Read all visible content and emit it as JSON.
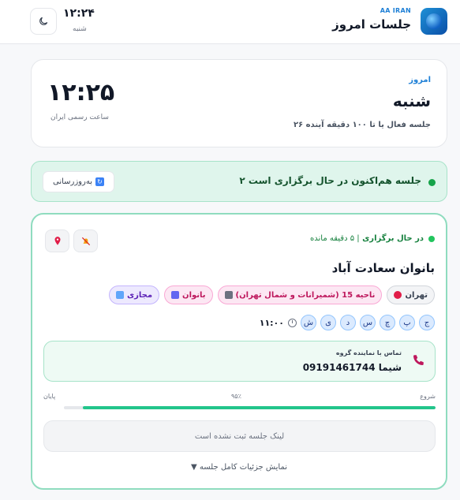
{
  "header": {
    "brand_small": "AA IRAN",
    "title": "جلسات امروز",
    "clock": "۱۲:۲۴",
    "day": "شنبه"
  },
  "today": {
    "label": "امروز",
    "day": "شنبه",
    "count_text": "۲۶ جلسه فعال یا تا ۱۰۰ دقیقه آینده",
    "clock": "۱۲:۲۵",
    "clock_sub": "ساعت رسمی ایران"
  },
  "live": {
    "text": "۲ جلسه هم‌اکنون در حال برگزاری است",
    "refresh_label": "به‌روزرسانی"
  },
  "session": {
    "status": "در حال برگزاری",
    "remaining": "| ۵ دقیقه مانده",
    "title": "بانوان سعادت آباد",
    "tags": {
      "virtual": "مجازی",
      "women": "بانوان",
      "region": "ناحیه 15 (شمیرانات و شمال تهران)",
      "city": "تهران"
    },
    "time": "۱۱:۰۰",
    "days": [
      "ش",
      "ی",
      "د",
      "س",
      "چ",
      "پ",
      "ج"
    ],
    "contact_label": "تماس با نماینده گروه",
    "contact_value": "شیما 09191461744",
    "progress": {
      "start": "شروع",
      "percent_text": "۹۵٪",
      "end": "پایان",
      "value": 0.95
    },
    "no_link": "لینک جلسه ثبت نشده است",
    "details_toggle": "▼ نمایش جزئیات کامل جلسه"
  },
  "colors": {
    "accent": "#1d7fd6",
    "live_bg": "#dff5ec",
    "progress": "#22c58b"
  }
}
